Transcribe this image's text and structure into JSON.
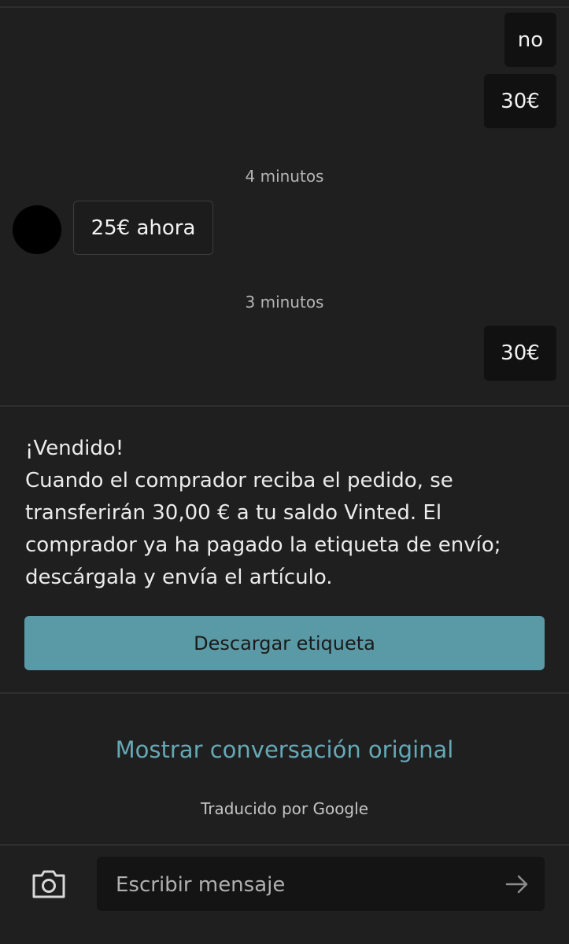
{
  "messages": [
    {
      "direction": "out",
      "text": "no"
    },
    {
      "direction": "out",
      "text": "30€"
    },
    {
      "type": "timestamp",
      "text": "4 minutos"
    },
    {
      "direction": "in",
      "text": "25€ ahora"
    },
    {
      "type": "timestamp",
      "text": "3 minutos"
    },
    {
      "direction": "out",
      "text": "30€"
    }
  ],
  "sold_card": {
    "title": "¡Vendido!",
    "body": "Cuando el comprador reciba el pedido, se transferirán 30,00 € a tu saldo Vinted. El comprador ya ha pagado la etiqueta de envío; descárgala y envía el artículo.",
    "button_label": "Descargar etiqueta"
  },
  "translation": {
    "show_original_label": "Mostrar conversación original",
    "attribution": "Traducido por Google"
  },
  "composer": {
    "placeholder": "Escribir mensaje",
    "value": "",
    "camera_icon": "camera-icon",
    "send_icon": "arrow-right-icon"
  },
  "colors": {
    "background": "#1f1f1f",
    "accent": "#5a9aa6",
    "link": "#64a9b6"
  }
}
